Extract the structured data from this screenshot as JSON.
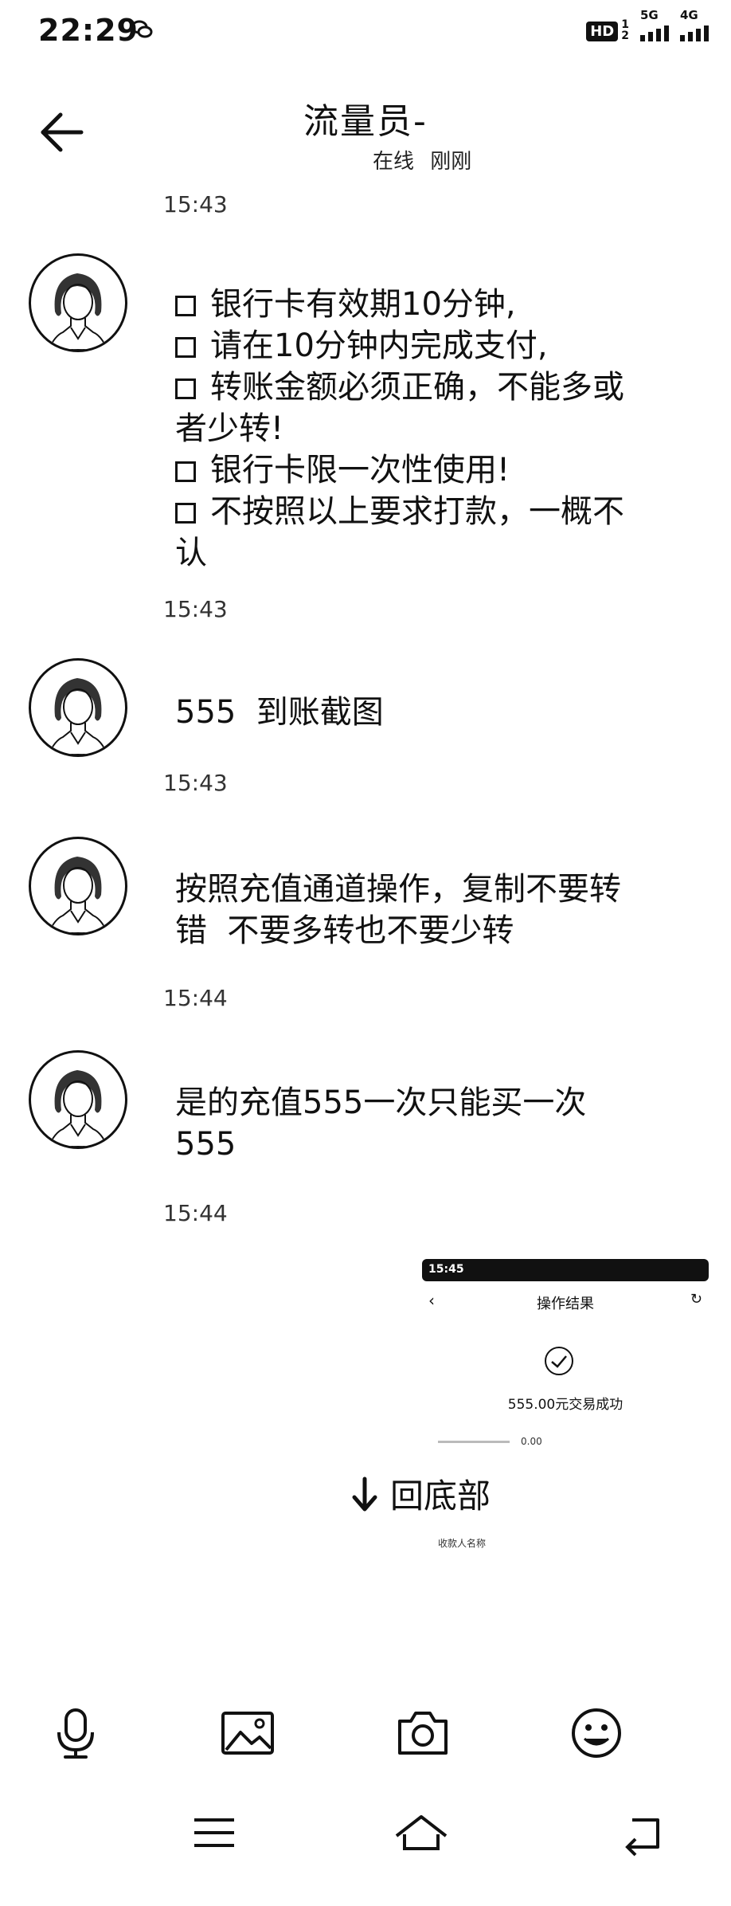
{
  "status_bar": {
    "time": "22:29",
    "hd": "HD",
    "sim1": "1",
    "sim2": "2",
    "net1": "5G",
    "net2": "4G"
  },
  "header": {
    "title": "流量员-",
    "online": "在线",
    "last_seen": "刚刚"
  },
  "messages": [
    {
      "time": "15:43",
      "lines": [
        "银行卡有效期10分钟,",
        "请在10分钟内完成支付,",
        "转账金额必须正确，不能多或",
        "者少转!",
        "银行卡限一次性使用!",
        "不按照以上要求打款，一概不",
        "认"
      ]
    },
    {
      "time": "15:43",
      "text": "555  到账截图"
    },
    {
      "time": "15:43",
      "lines": [
        "按照充值通道操作，复制不要转",
        "错  不要多转也不要少转"
      ]
    },
    {
      "time": "15:44",
      "lines": [
        "是的充值555一次只能买一次",
        "555"
      ]
    },
    {
      "time": "15:44"
    }
  ],
  "image_message": {
    "status_time": "15:45",
    "title": "操作结果",
    "amount_text": "555.00元交易成功",
    "row1_value": "0.00",
    "row2_label": "收款人名称"
  },
  "scroll_to_bottom": {
    "label": "回底部"
  },
  "toolbar": [
    "microphone-icon",
    "image-icon",
    "camera-icon",
    "emoji-icon"
  ],
  "navbar": [
    "menu-icon",
    "home-icon",
    "back-icon"
  ]
}
